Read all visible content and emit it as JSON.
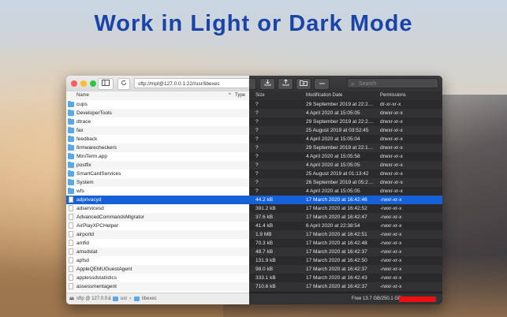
{
  "headline": "Work in Light or Dark Mode",
  "window": {
    "address": "sftp://mpl@127.0.0.1:22//usr/libexec",
    "search_placeholder": "Search",
    "columns": {
      "name": "Name",
      "type": "Type",
      "size": "Size",
      "modified": "Modification Date",
      "permissions": "Permissions"
    },
    "rows": [
      {
        "name": "cups",
        "kind": "folder",
        "size": "?",
        "modified": "29 September 2019 at 22:2…",
        "perm": "dr-xr-xr-x"
      },
      {
        "name": "DeveloperTools",
        "kind": "folder",
        "size": "?",
        "modified": "4 April 2020 at 15:05:05",
        "perm": "drwxr-xr-x"
      },
      {
        "name": "dtrace",
        "kind": "folder",
        "size": "?",
        "modified": "29 September 2019 at 22:2…",
        "perm": "drwxr-xr-x"
      },
      {
        "name": "fax",
        "kind": "folder",
        "size": "?",
        "modified": "25 August 2019 at 03:52:45",
        "perm": "drwxr-xr-x"
      },
      {
        "name": "feedback",
        "kind": "folder",
        "size": "?",
        "modified": "4 April 2020 at 15:05:04",
        "perm": "drwxr-xr-x"
      },
      {
        "name": "firmwarecheckers",
        "kind": "folder",
        "size": "?",
        "modified": "29 September 2019 at 22:1…",
        "perm": "drwxr-xr-x"
      },
      {
        "name": "MiniTerm.app",
        "kind": "folder",
        "size": "?",
        "modified": "4 April 2020 at 15:05:58",
        "perm": "drwxr-xr-x"
      },
      {
        "name": "postfix",
        "kind": "folder",
        "size": "?",
        "modified": "4 April 2020 at 15:05:05",
        "perm": "drwxr-xr-x"
      },
      {
        "name": "SmartCardServices",
        "kind": "folder",
        "size": "?",
        "modified": "25 August 2019 at 01:13:42",
        "perm": "drwxr-xr-x"
      },
      {
        "name": "System",
        "kind": "folder",
        "size": "?",
        "modified": "26 September 2019 at 05:2…",
        "perm": "drwxr-xr-x"
      },
      {
        "name": "wfs",
        "kind": "folder",
        "size": "?",
        "modified": "4 April 2020 at 15:05:05",
        "perm": "drwxr-xr-x"
      },
      {
        "name": "adprivacyd",
        "kind": "file",
        "size": "44.2 kB",
        "modified": "17 March 2020 at 16:42:46",
        "perm": "-rwxr-xr-x",
        "selected": true
      },
      {
        "name": "adservicesd",
        "kind": "file",
        "size": "391.2 kB",
        "modified": "17 March 2020 at 16:42:52",
        "perm": "-rwxr-xr-x"
      },
      {
        "name": "AdvancedCommandsMigrator",
        "kind": "file",
        "size": "37.6 kB",
        "modified": "17 March 2020 at 16:42:47",
        "perm": "-rwxr-xr-x"
      },
      {
        "name": "AirPlayXPCHelper",
        "kind": "file",
        "size": "41.4 kB",
        "modified": "6 April 2020 at 22:38:54",
        "perm": "-rwxr-xr-x"
      },
      {
        "name": "airportd",
        "kind": "file",
        "size": "1.9 MB",
        "modified": "17 March 2020 at 16:42:51",
        "perm": "-rwxr-xr-x"
      },
      {
        "name": "amfid",
        "kind": "file",
        "size": "70.3 kB",
        "modified": "17 March 2020 at 16:42:48",
        "perm": "-rwxr-xr-x"
      },
      {
        "name": "amsdstat",
        "kind": "file",
        "size": "48.7 kB",
        "modified": "17 March 2020 at 16:42:37",
        "perm": "-rwxr-xr-x"
      },
      {
        "name": "apfsd",
        "kind": "file",
        "size": "131.9 kB",
        "modified": "17 March 2020 at 16:42:50",
        "perm": "-rwxr-xr-x"
      },
      {
        "name": "AppleQEMUGuestAgent",
        "kind": "file",
        "size": "98.0 kB",
        "modified": "17 March 2020 at 16:42:37",
        "perm": "-rwxr-xr-x"
      },
      {
        "name": "applessdstatistics",
        "kind": "file",
        "size": "333.1 kB",
        "modified": "17 March 2020 at 16:42:43",
        "perm": "-rwxr-xr-x"
      },
      {
        "name": "assessmentagent",
        "kind": "file",
        "size": "710.6 kB",
        "modified": "17 March 2020 at 16:42:37",
        "perm": "-rwxr-xr-x"
      }
    ],
    "footer": {
      "path_root": "sftp @ 127.0.0.1",
      "path_usr": "usr",
      "path_libexec": "libexec",
      "free": "Free 13.7 GB/250.1 GB",
      "used_fraction": 0.95
    }
  }
}
